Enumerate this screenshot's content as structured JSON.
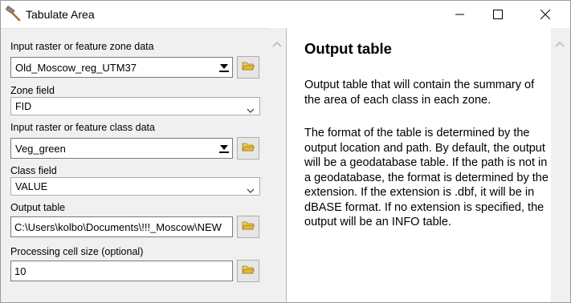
{
  "window": {
    "title": "Tabulate Area",
    "icons": {
      "app": "hammer-icon",
      "minimize": "minimize-icon",
      "maximize": "maximize-icon",
      "close": "close-icon"
    }
  },
  "form": {
    "zone_data": {
      "label": "Input raster or feature zone data",
      "value": "Old_Moscow_reg_UTM37"
    },
    "zone_field": {
      "label": "Zone field",
      "value": "FID"
    },
    "class_data": {
      "label": "Input raster or feature class data",
      "value": "Veg_green"
    },
    "class_field": {
      "label": "Class field",
      "value": "VALUE"
    },
    "output_table": {
      "label": "Output table",
      "value": "C:\\Users\\kolbo\\Documents\\!!!_Moscow\\NEW"
    },
    "cell_size": {
      "label": "Processing cell size (optional)",
      "value": "10"
    },
    "browse_icon": "folder-open-icon"
  },
  "help": {
    "title": "Output table",
    "paragraph_1": "Output table that will contain the summary of the area of each class in each zone.",
    "paragraph_2": "The format of the table is determined by the output location and path. By default, the output will be a geodatabase table. If the path is not in a geodatabase, the format is determined by the extension. If the extension is .dbf, it will be in dBASE format. If no extension is specified, the output will be an INFO table."
  },
  "colors": {
    "panel_bg": "#f0f0f0",
    "border": "#7a7a7a",
    "folder": "#e8b830"
  }
}
